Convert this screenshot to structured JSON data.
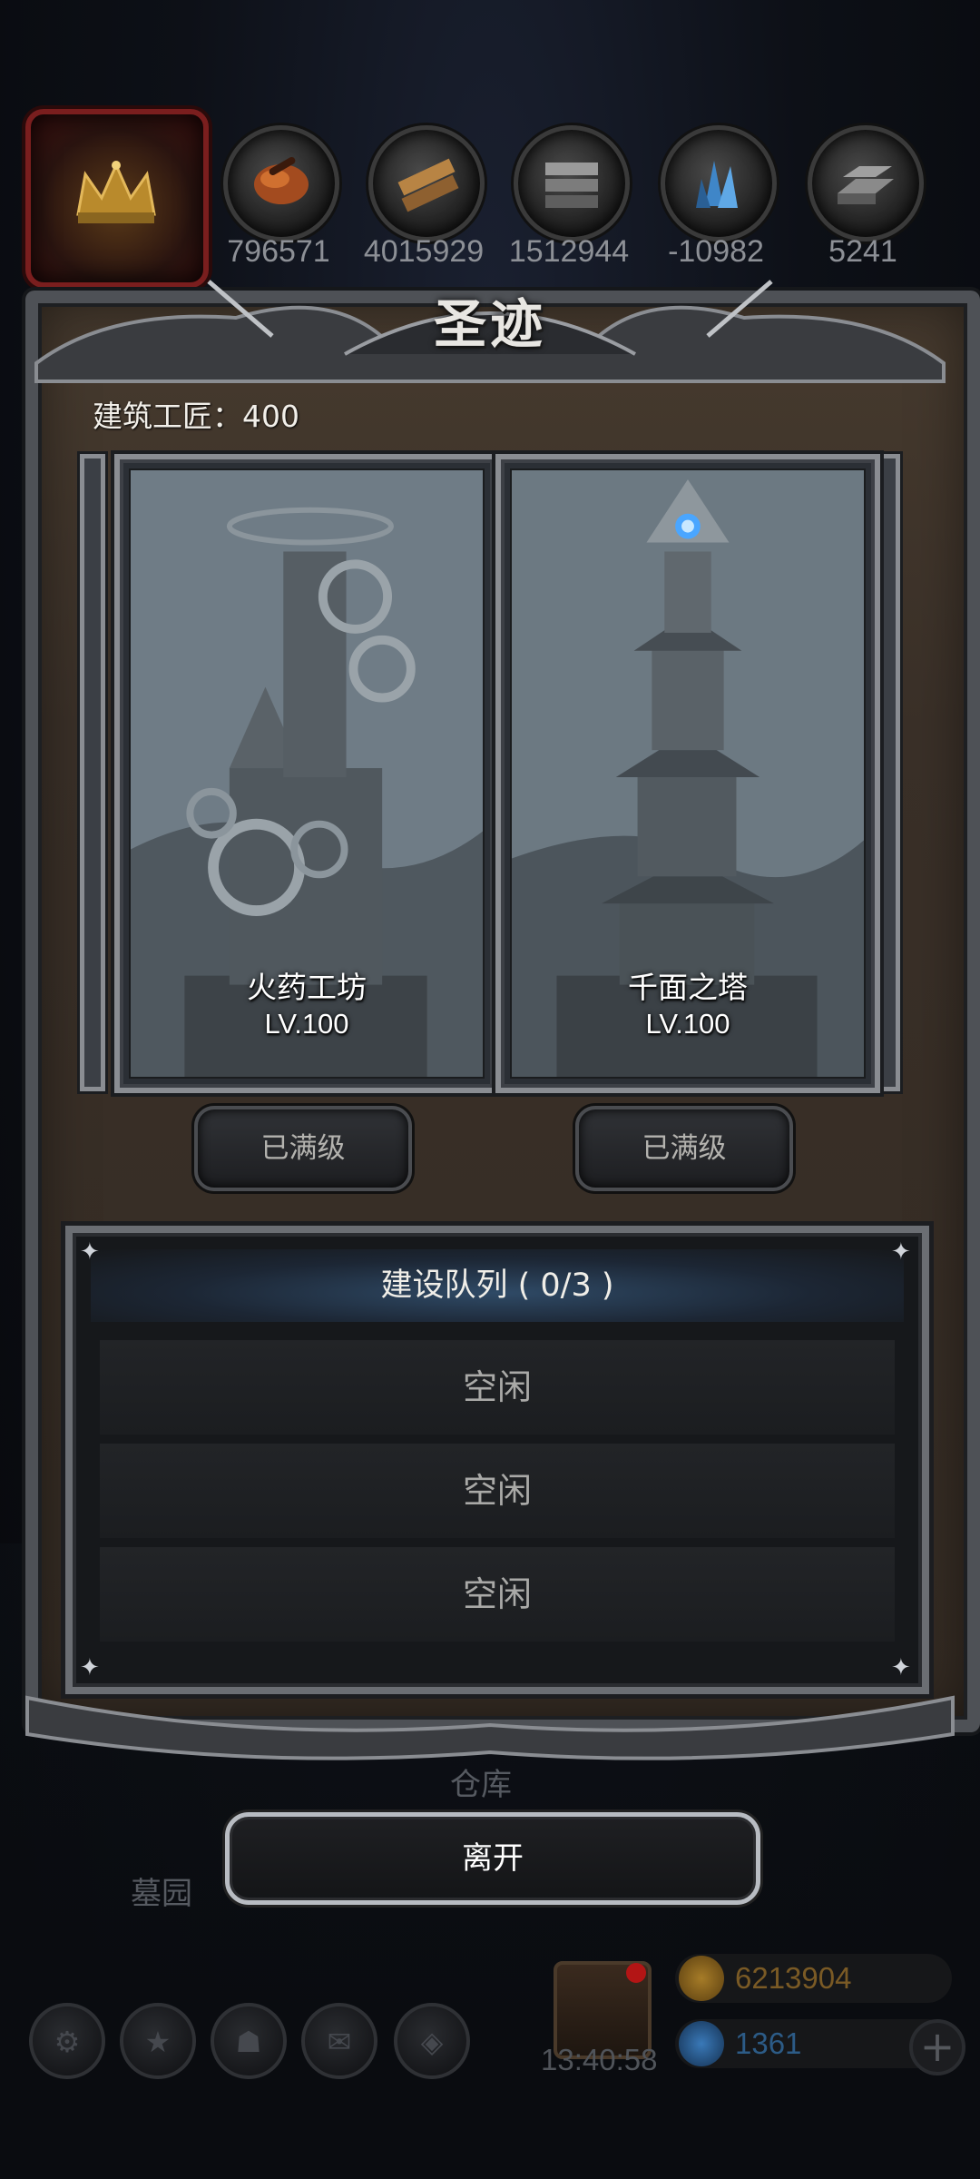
{
  "resources": [
    {
      "icon": "orange-ore-icon",
      "value": "796571"
    },
    {
      "icon": "wood-plank-icon",
      "value": "4015929"
    },
    {
      "icon": "stone-block-icon",
      "value": "1512944"
    },
    {
      "icon": "blue-crystal-icon",
      "value": "-10982"
    },
    {
      "icon": "iron-ingot-icon",
      "value": "5241"
    }
  ],
  "panel": {
    "title": "圣迹",
    "craftsman_label": "建筑工匠：400"
  },
  "buildings": [
    {
      "name": "火药工坊",
      "level": "LV.100",
      "button": "已满级"
    },
    {
      "name": "千面之塔",
      "level": "LV.100",
      "button": "已满级"
    }
  ],
  "queue": {
    "header": "建设队列 ( 0/3 )",
    "slots": [
      "空闲",
      "空闲",
      "空闲"
    ]
  },
  "background": {
    "warehouse_label": "仓库",
    "cemetery_label": "墓园"
  },
  "leave_button": "离开",
  "bottom": {
    "timer": "13:40:58",
    "gold": "6213904",
    "gems": "1361"
  },
  "colors": {
    "gold_text": "#7a5a25",
    "gem_text": "#2c5b86",
    "panel_brown": "#3a3028"
  }
}
